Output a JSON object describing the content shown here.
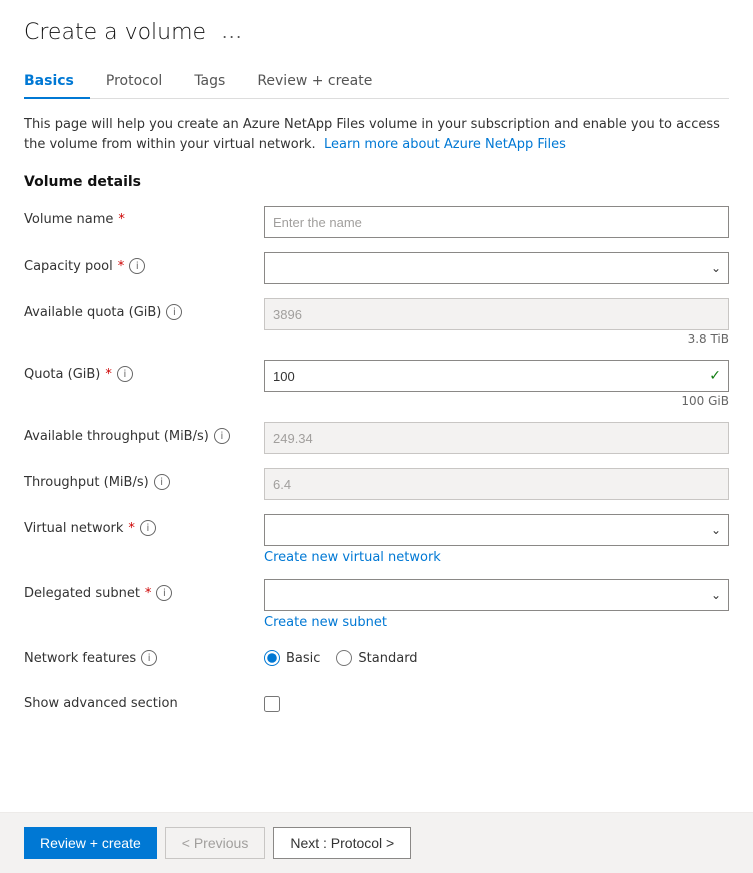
{
  "page": {
    "title": "Create a volume",
    "ellipsis": "...",
    "tabs": [
      {
        "id": "basics",
        "label": "Basics",
        "active": true
      },
      {
        "id": "protocol",
        "label": "Protocol",
        "active": false
      },
      {
        "id": "tags",
        "label": "Tags",
        "active": false
      },
      {
        "id": "review",
        "label": "Review + create",
        "active": false
      }
    ],
    "info_text": "This page will help you create an Azure NetApp Files volume in your subscription and enable you to access the volume from within your virtual network.",
    "learn_more_text": "Learn more about Azure NetApp Files",
    "section_title": "Volume details"
  },
  "form": {
    "volume_name": {
      "label": "Volume name",
      "required": true,
      "placeholder": "Enter the name",
      "value": ""
    },
    "capacity_pool": {
      "label": "Capacity pool",
      "required": true,
      "value": ""
    },
    "available_quota": {
      "label": "Available quota (GiB)",
      "required": false,
      "value": "3896",
      "sub_label": "3.8 TiB"
    },
    "quota": {
      "label": "Quota (GiB)",
      "required": true,
      "value": "100",
      "sub_label": "100 GiB"
    },
    "available_throughput": {
      "label": "Available throughput (MiB/s)",
      "required": false,
      "value": "249.34"
    },
    "throughput": {
      "label": "Throughput (MiB/s)",
      "required": false,
      "value": "6.4"
    },
    "virtual_network": {
      "label": "Virtual network",
      "required": true,
      "value": "",
      "create_link": "Create new virtual network"
    },
    "delegated_subnet": {
      "label": "Delegated subnet",
      "required": true,
      "value": "",
      "create_link": "Create new subnet"
    },
    "network_features": {
      "label": "Network features",
      "required": false,
      "options": [
        {
          "id": "basic",
          "label": "Basic",
          "checked": true
        },
        {
          "id": "standard",
          "label": "Standard",
          "checked": false
        }
      ]
    },
    "show_advanced": {
      "label": "Show advanced section",
      "checked": false
    }
  },
  "footer": {
    "review_create_label": "Review + create",
    "previous_label": "< Previous",
    "next_label": "Next : Protocol >"
  }
}
